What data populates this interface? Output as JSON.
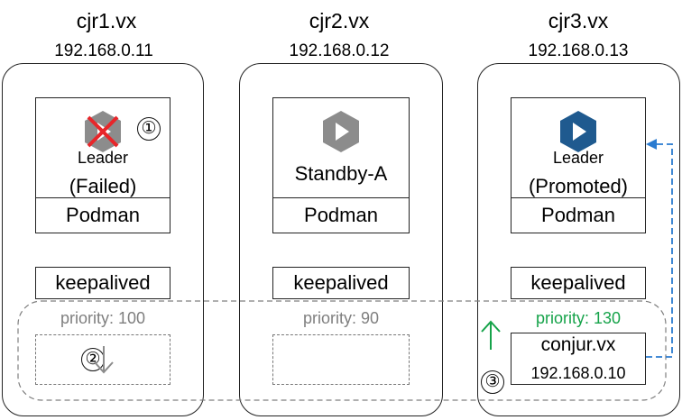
{
  "hosts": [
    {
      "name": "cjr1.vx",
      "ip": "192.168.0.11",
      "role": "Leader",
      "status": "(Failed)",
      "runtime": "Podman",
      "service": "keepalived",
      "priority": "priority: 100",
      "step": "①"
    },
    {
      "name": "cjr2.vx",
      "ip": "192.168.0.12",
      "role": "Standby-A",
      "runtime": "Podman",
      "service": "keepalived",
      "priority": "priority: 90"
    },
    {
      "name": "cjr3.vx",
      "ip": "192.168.0.13",
      "role": "Leader",
      "status": "(Promoted)",
      "runtime": "Podman",
      "service": "keepalived",
      "priority": "priority: 130"
    }
  ],
  "steps": {
    "step2": "②",
    "step3": "③"
  },
  "vip": {
    "name": "conjur.vx",
    "ip": "192.168.0.10"
  },
  "colors": {
    "failed_x": "#e8262a",
    "hex_gray": "#8c8c8c",
    "hex_blue": "#1f5a8f",
    "priority_gray": "#7f7f7f",
    "priority_green": "#16a34a",
    "arrow_blue": "#2a7bd0",
    "arrow_green": "#16a34a"
  },
  "icons": [
    "hexagon-play-icon",
    "failed-x-icon",
    "down-arrow-icon",
    "up-arrow-icon",
    "failover-arrow-icon"
  ]
}
